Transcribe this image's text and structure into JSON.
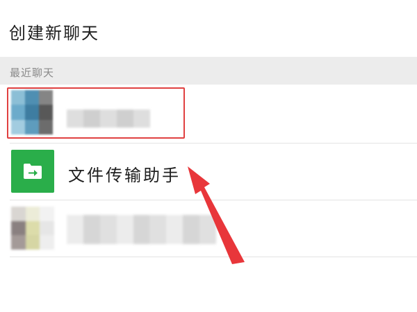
{
  "header": {
    "title": "创建新聊天"
  },
  "recent_section": {
    "label": "最近聊天"
  },
  "chats": [
    {
      "name": ""
    },
    {
      "name": "文件传输助手",
      "icon": "folder-arrow-icon",
      "icon_color": "#2aae4a"
    },
    {
      "name": ""
    }
  ],
  "annotation": {
    "box_color": "#e04040",
    "arrow_color": "#e8363a"
  }
}
